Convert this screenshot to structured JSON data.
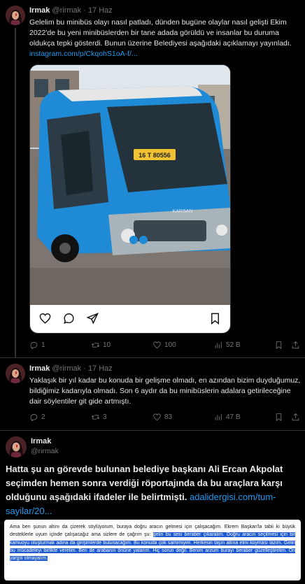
{
  "tweets": [
    {
      "name": "Irmak",
      "handle": "@rirmak",
      "sep": "·",
      "date": "17 Haz",
      "text": "Gelelim bu minibüs olayı nasıl patladı, dünden bugüne olaylar nasıl gelişti Ekim 2022'de bu yeni minibüslerden bir tane adada görüldü ve insanlar bu duruma oldukça tepki gösterdi. Bunun üzerine Belediyesi aşağıdaki açıklamayı yayınladı.",
      "link": "instagram.com/p/CkqohS1oA-f/...",
      "media": {
        "plate": "16 T 80556",
        "brand": "KARSAN"
      },
      "stats": {
        "replies": "1",
        "reposts": "10",
        "likes": "100",
        "views": "52 B"
      }
    },
    {
      "name": "Irmak",
      "handle": "@rirmak",
      "sep": "·",
      "date": "17 Haz",
      "text": "Yaklaşık bir yıl kadar bu konuda bir gelişme olmadı, en azından bizim duyduğumuz, bildiğimiz kadarıyla olmadı. Son 6 aydır da bu minibüslerin adalara getirileceğine dair söylentiler git gide artmıştı.",
      "stats": {
        "replies": "2",
        "reposts": "3",
        "likes": "83",
        "views": "47 B"
      }
    },
    {
      "name": "Irmak",
      "handle": "@rirmak",
      "text": "Hatta şu an görevde bulunan belediye başkanı Ali Ercan Akpolat seçimden hemen sonra verdiği röportajında da bu araçlara karşı olduğunu aşağıdaki ifadeler ile belirtmişti.",
      "link": "adalidergisi.com/tum-sayilar/20...",
      "quote_plain": "Ama ben şunun altını da çizerek söylüyorum, buraya doğru aracın gelmesi için çalışacağım. Ekrem Başkan'la tabii ki büyük desteklerle uyum içinde çalışacağız ama sizlere de çağrım şu:",
      "quote_highlight": "gelin bu sesi beraber çıkaralım. Doğru aracın seçilmesi için bir kamuoyu oluşturmak adına da girişimlerde bulunacağım. Bu konuda çok samimiyim. Herkesin taşın altına elini koyması lazım. Gelin bu mücadeleyi birlikte verelim. Ben de arabanın önüne yatarım. Hiç sorun değil. Benim arzum burayı beraber güzelleştirelim. Ön yargılı olmayalım."
    }
  ],
  "icons": {
    "reply": "reply-icon",
    "repost": "repost-icon",
    "like": "heart-icon",
    "views": "views-icon",
    "bookmark": "bookmark-icon",
    "share": "share-icon"
  },
  "colors": {
    "background": "#000000",
    "text": "#e7e9ea",
    "muted": "#71767b",
    "link": "#1d9bf0",
    "highlight": "#1e5ad2",
    "bus_blue": "#1f8ad6"
  }
}
